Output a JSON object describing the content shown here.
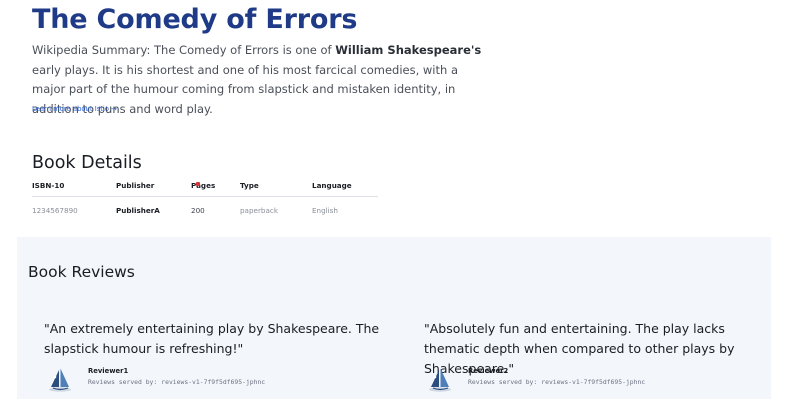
{
  "book": {
    "title": "The Comedy of Errors",
    "summary_prefix": "Wikipedia Summary: The Comedy of Errors is one of ",
    "summary_author": "William Shakespeare's",
    "summary_suffix": " early plays. It is his shortest and one of his most farcical comedies, with a major part of the humour coming from slapstick and mistaken identity, in addition to puns and word play.",
    "learn_more": "Learn more about Istio →"
  },
  "details": {
    "heading": "Book Details",
    "columns": [
      "ISBN-10",
      "Publisher",
      "Pages",
      "Type",
      "Language"
    ],
    "row": {
      "isbn": "1234567890",
      "publisher": "PublisherA",
      "pages": "200",
      "type": "paperback",
      "language": "English"
    }
  },
  "reviews": {
    "heading": "Book Reviews",
    "served_by_label": "Reviews served by:",
    "items": [
      {
        "text": "\"An extremely entertaining play by Shakespeare. The slapstick humour is refreshing!\"",
        "reviewer": "Reviewer1",
        "pod": "reviews-v1-7f9f5df695-jphnc"
      },
      {
        "text": "\"Absolutely fun and entertaining. The play lacks thematic depth when compared to other plays by Shakespeare.\"",
        "reviewer": "Reviewer2",
        "pod": "reviews-v1-7f9f5df695-jphnc"
      }
    ]
  },
  "colors": {
    "title": "#1f3b87",
    "link": "#2d62d6",
    "reviews_bg": "#f3f6fb"
  },
  "icons": {
    "avatar": "sailboat-avatar-icon"
  }
}
